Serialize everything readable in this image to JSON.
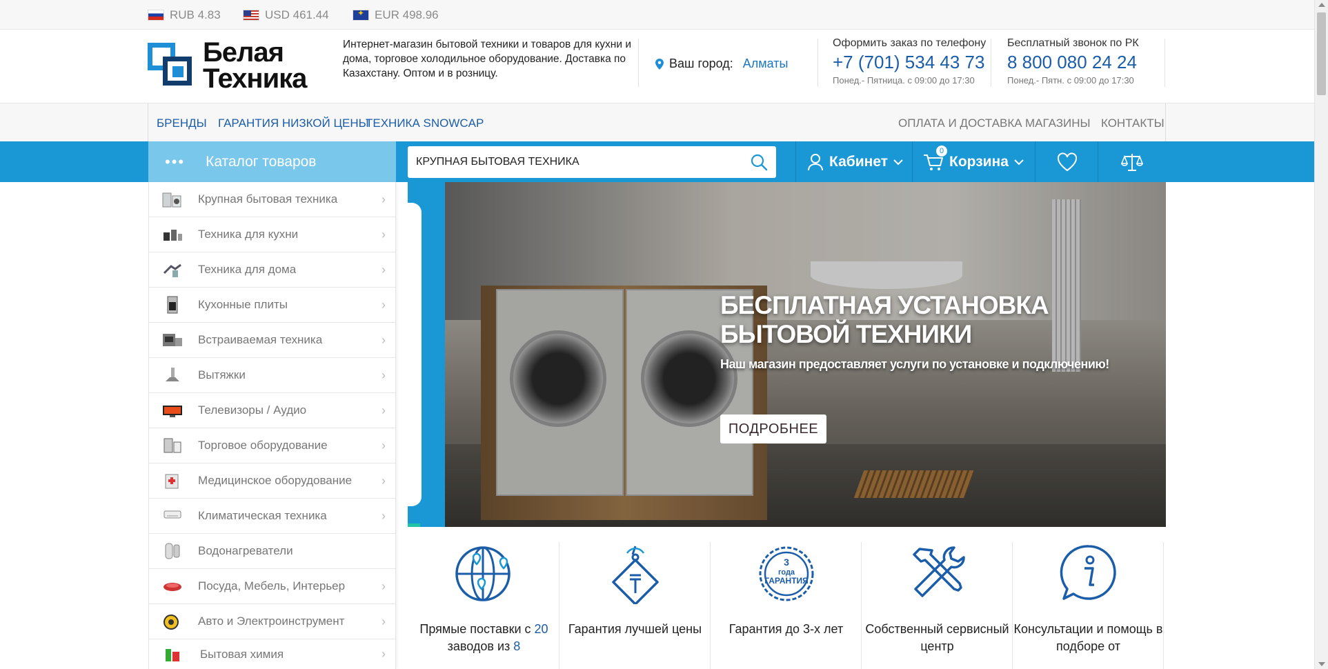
{
  "currencies": [
    {
      "code": "RUB",
      "value": "RUB 4.83",
      "flag": "ru-flag-icon"
    },
    {
      "code": "USD",
      "value": "USD 461.44",
      "flag": "us-flag-icon"
    },
    {
      "code": "EUR",
      "value": "EUR 498.96",
      "flag": "eu-flag-icon"
    }
  ],
  "header": {
    "logo_line1": "Белая",
    "logo_line2": "Техника",
    "tagline": "Интернет-магазин бытовой техники и товаров для кухни и дома, торговое холодильное оборудование. Доставка по Казахстану. Оптом и в розницу.",
    "city_label": "Ваш город:",
    "city_value": "Алматы",
    "phone1_label": "Оформить заказ по телефону",
    "phone1": "+7 (701) 534 43 73",
    "phone1_hours": "Понед.- Пятница. с 09:00 до 17:30",
    "phone2_label": "Бесплатный звонок по РК",
    "phone2": "8 800 080 24 24",
    "phone2_hours": "Понед.- Пятн. с 09:00 до 17:30"
  },
  "topnav": {
    "left": [
      "БРЕНДЫ",
      "ГАРАНТИЯ НИЗКОЙ ЦЕНЫ",
      "ТЕХНИКА SNOWCAP"
    ],
    "right": [
      "ОПЛАТА И ДОСТАВКА",
      "МАГАЗИНЫ",
      "КОНТАКТЫ"
    ]
  },
  "bar": {
    "catalog": "Каталог товаров",
    "search_value": "КРУПНАЯ БЫТОВАЯ ТЕХНИКА",
    "cabinet": "Кабинет",
    "cart": "Корзина",
    "cart_count": "0"
  },
  "sidebar": [
    {
      "label": "Крупная бытовая техника",
      "chevron": true
    },
    {
      "label": "Техника для кухни",
      "chevron": true
    },
    {
      "label": "Техника для дома",
      "chevron": true
    },
    {
      "label": "Кухонные плиты",
      "chevron": true
    },
    {
      "label": "Встраиваемая техника",
      "chevron": true
    },
    {
      "label": "Вытяжки",
      "chevron": true
    },
    {
      "label": "Телевизоры / Аудио",
      "chevron": true
    },
    {
      "label": "Торговое оборудование",
      "chevron": true
    },
    {
      "label": "Медицинское оборудование",
      "chevron": true
    },
    {
      "label": "Климатическая техника",
      "chevron": true
    },
    {
      "label": "Водонагреватели",
      "chevron": false
    },
    {
      "label": "Посуда, Мебель, Интерьер",
      "chevron": true
    },
    {
      "label": "Авто и Электроинструмент",
      "chevron": true
    },
    {
      "label": "Бытовая химия",
      "chevron": true
    }
  ],
  "banner": {
    "title": "БЕСПЛАТНАЯ УСТАНОВКА БЫТОВОЙ ТЕХНИКИ",
    "subtitle": "Наш магазин предоставляет услуги по установке и подключению!",
    "button": "ПОДРОБНЕЕ"
  },
  "features": [
    {
      "icon": "globe-pins-icon",
      "pre": "Прямые поставки с ",
      "hl1": "20",
      "mid": " заводов из ",
      "hl2": "8",
      "post": ""
    },
    {
      "icon": "price-tag-icon",
      "pre": "Гарантия лучшей цены",
      "hl1": "",
      "mid": "",
      "hl2": "",
      "post": ""
    },
    {
      "icon": "warranty-seal-icon",
      "pre": "Гарантия до 3-х лет",
      "hl1": "",
      "mid": "",
      "hl2": "",
      "post": ""
    },
    {
      "icon": "tools-icon",
      "pre": "Собственный сервисный центр",
      "hl1": "",
      "mid": "",
      "hl2": "",
      "post": ""
    },
    {
      "icon": "info-bubble-icon",
      "pre": "Консультации и помощь в подборе от",
      "hl1": "",
      "mid": "",
      "hl2": "",
      "post": ""
    }
  ],
  "seal_text": {
    "num": "3",
    "word": "года",
    "label": "ГАРАНТИЯ"
  },
  "colors": {
    "brand_blue": "#1a97d5",
    "dark_blue": "#1b5da8",
    "catalog_bg": "#7ac7ec"
  }
}
